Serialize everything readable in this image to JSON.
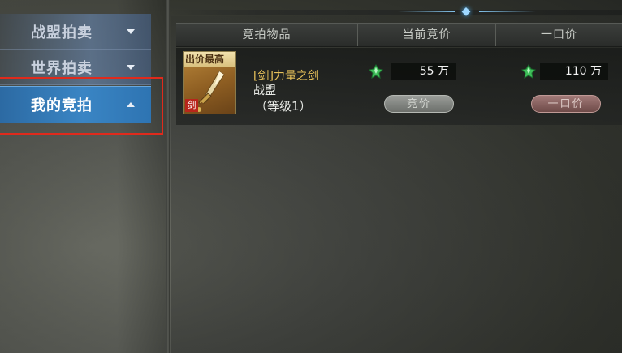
{
  "sidebar": {
    "tabs": [
      {
        "label": "战盟拍卖"
      },
      {
        "label": "世界拍卖"
      },
      {
        "label": "我的竞拍"
      }
    ]
  },
  "table": {
    "headers": [
      "竞拍物品",
      "当前竞价",
      "一口价"
    ],
    "rows": [
      {
        "ribbon": "出价最高",
        "type_badge": "剑",
        "name": "[剑]力量之剑",
        "owner": "战盟",
        "level": "（等级1）",
        "current_price": "55 万",
        "buyout_price": "110 万",
        "bid_label": "竞价",
        "buyout_label": "一口价"
      }
    ]
  },
  "colors": {
    "active_tab": "#3a85c4",
    "highlight": "#e02a1c",
    "item_name": "#e8c25a"
  },
  "icons": [
    "sword-icon",
    "green-gem-icon",
    "chevron-down-icon",
    "chevron-up-icon",
    "diamond-ornament-icon"
  ]
}
